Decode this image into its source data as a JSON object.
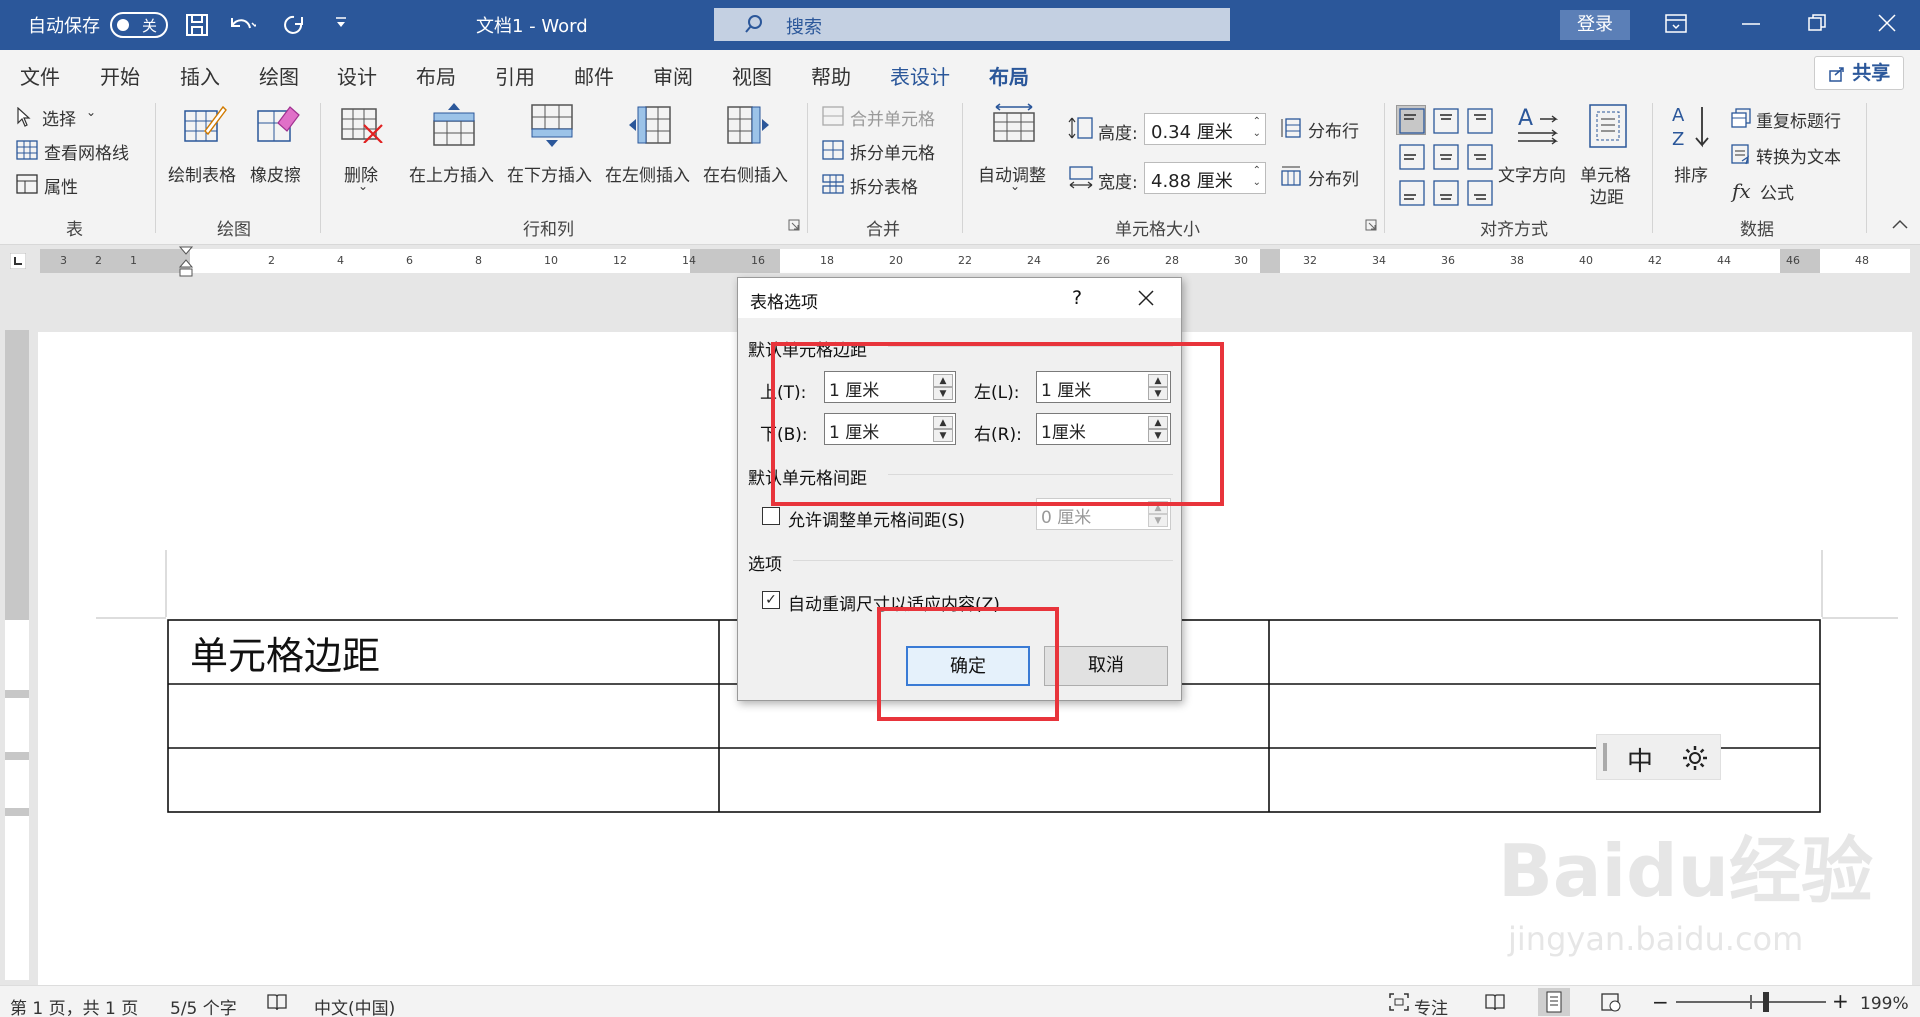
{
  "titlebar": {
    "autosave_label": "自动保存",
    "autosave_state": "关",
    "doc_title": "文档1 - Word",
    "search_placeholder": "搜索",
    "login_label": "登录"
  },
  "menu": {
    "items": [
      "文件",
      "开始",
      "插入",
      "绘图",
      "设计",
      "布局",
      "引用",
      "邮件",
      "审阅",
      "视图",
      "帮助",
      "表设计",
      "布局"
    ],
    "share_label": "共享"
  },
  "ribbon": {
    "table_group": {
      "select": "选择",
      "gridlines": "查看网格线",
      "properties": "属性",
      "name": "表"
    },
    "draw_group": {
      "draw_table": "绘制表格",
      "eraser": "橡皮擦",
      "name": "绘图"
    },
    "rowcol_group": {
      "delete": "删除",
      "insert_above": "在上方插入",
      "insert_below": "在下方插入",
      "insert_left": "在左侧插入",
      "insert_right": "在右侧插入",
      "name": "行和列"
    },
    "merge_group": {
      "merge_cells": "合并单元格",
      "split_cells": "拆分单元格",
      "split_table": "拆分表格",
      "name": "合并"
    },
    "cellsize_group": {
      "autofit": "自动调整",
      "height_label": "高度:",
      "height_value": "0.34 厘米",
      "width_label": "宽度:",
      "width_value": "4.88 厘米",
      "distribute_rows": "分布行",
      "distribute_cols": "分布列",
      "name": "单元格大小"
    },
    "align_group": {
      "text_direction": "文字方向",
      "cell_margins_1": "单元格",
      "cell_margins_2": "边距",
      "name": "对齐方式"
    },
    "data_group": {
      "sort": "排序",
      "repeat_header": "重复标题行",
      "convert_text": "转换为文本",
      "formula": "公式",
      "name": "数据"
    }
  },
  "ruler": {
    "left_ticks": [
      "3",
      "2",
      "1"
    ],
    "ticks": [
      "2",
      "4",
      "6",
      "8",
      "10",
      "12",
      "14",
      "16",
      "18",
      "20",
      "22",
      "24",
      "26",
      "28",
      "30",
      "32",
      "34",
      "36",
      "38",
      "40",
      "42",
      "44",
      "46",
      "48"
    ]
  },
  "document": {
    "cell_text": "单元格边距",
    "ime_label": "中"
  },
  "dialog": {
    "title": "表格选项",
    "help": "?",
    "section_margins": "默认单元格边距",
    "top_label": "上(T):",
    "top_value": "1 厘米",
    "left_label": "左(L):",
    "left_value": "1 厘米",
    "bottom_label": "下(B):",
    "bottom_value": "1 厘米",
    "right_label": "右(R):",
    "right_value": "1厘米",
    "section_spacing": "默认单元格间距",
    "allow_spacing_label": "允许调整单元格间距(S)",
    "allow_spacing_checked": false,
    "spacing_value": "0 厘米",
    "section_options": "选项",
    "autofit_label": "自动重调尺寸以适应内容(Z)",
    "autofit_checked": true,
    "ok_label": "确定",
    "cancel_label": "取消"
  },
  "statusbar": {
    "page_info": "第 1 页，共 1 页",
    "word_count": "5/5 个字",
    "language": "中文(中国)",
    "focus": "专注",
    "zoom": "199%"
  },
  "watermark": {
    "brand": "Baidu经验",
    "url": "jingyan.baidu.com"
  },
  "colors": {
    "accent": "#2b579a",
    "highlight": "#e8343b"
  }
}
